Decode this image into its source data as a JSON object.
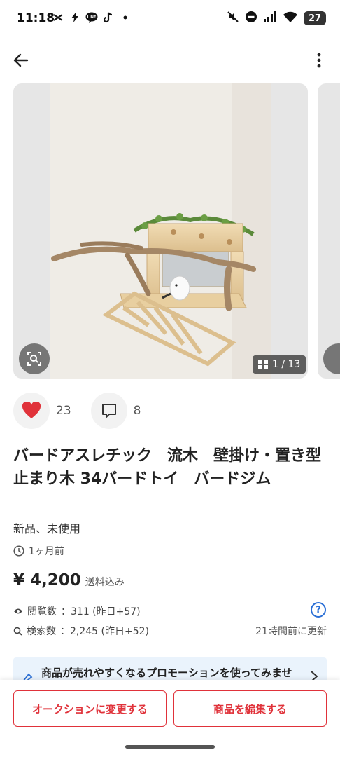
{
  "status_bar": {
    "time": "11:18",
    "battery": "27",
    "left_icons": [
      "capcut-icon",
      "bolt-app-icon",
      "line-icon",
      "tiktok-icon",
      "dot-icon"
    ],
    "right_icons": [
      "mute-icon",
      "dnd-icon",
      "signal-icon",
      "wifi-icon",
      "battery-icon"
    ]
  },
  "top_bar": {
    "back_icon": "arrow-left-icon",
    "more_icon": "more-vertical-icon"
  },
  "gallery": {
    "counter": "1 / 13",
    "current_index": 1,
    "total": 13
  },
  "reactions": {
    "likes": "23",
    "comments": "8",
    "like_color": "#e0323a"
  },
  "product": {
    "title": "バードアスレチック　流木　壁掛け・置き型　 止まり木 34バードトイ　バードジム",
    "condition": "新品、未使用",
    "posted": "1ヶ月前",
    "price": "¥ 4,200",
    "shipping": "送料込み"
  },
  "stats": {
    "views_label": "閲覧数",
    "views_value": "：311 (昨日+57)",
    "search_label": "検索数",
    "search_value": "：2,245 (昨日+52)",
    "updated": "21時間前に更新"
  },
  "promo": {
    "text": "商品が売れやすくなるプロモーションを使ってみませ"
  },
  "actions": {
    "auction": "オークションに変更する",
    "edit": "商品を編集する"
  },
  "colors": {
    "accent": "#e0323a",
    "info": "#2a6fd6",
    "promo_bg": "#eaf3fc"
  }
}
